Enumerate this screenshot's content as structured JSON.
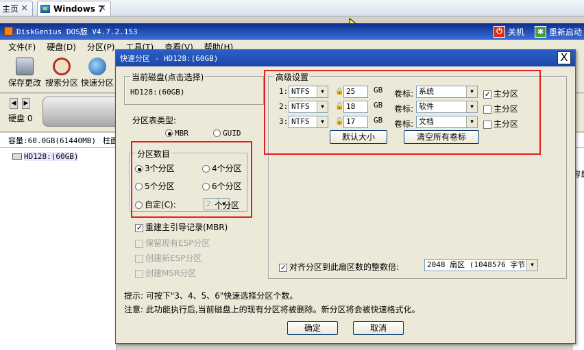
{
  "vm_tabs": [
    {
      "label": "主页"
    },
    {
      "label": "Windows 7"
    }
  ],
  "app": {
    "title": "DiskGenius DOS版 V4.7.2.153",
    "shutdown": "关机",
    "restart": "重新启动",
    "menu": [
      "文件(F)",
      "硬盘(D)",
      "分区(P)",
      "工具(T)",
      "查看(V)",
      "帮助(H)"
    ],
    "tools": [
      "保存更改",
      "搜索分区",
      "快速分区"
    ],
    "disk_label": "硬盘 0",
    "capacity": "容量:60.0GB(61440MB)",
    "cylinders": "柱面数",
    "tree_item": "HD128:(60GB)",
    "right_edge": "容量"
  },
  "dialog": {
    "title": "快速分区 - HD128:(60GB)",
    "close": "X",
    "current_disk": {
      "label": "当前磁盘(点击选择)",
      "value": "HD128:(60GB)"
    },
    "table_type": {
      "label": "分区表类型:",
      "options": [
        "MBR",
        "GUID"
      ],
      "selected": "MBR"
    },
    "count": {
      "label": "分区数目",
      "options": [
        "3个分区",
        "4个分区",
        "5个分区",
        "6个分区"
      ],
      "selected": "3个分区",
      "custom_label": "自定(C):",
      "custom_value": "2",
      "custom_suffix": "个分区"
    },
    "rebuild_mbr": {
      "label": "重建主引导记录(MBR)",
      "checked": true
    },
    "keep_esp": "保留现有ESP分区",
    "create_esp": "创建新ESP分区",
    "create_msr": "创建MSR分区",
    "advanced": {
      "label": "高级设置",
      "rows": [
        {
          "index": "1:",
          "fs": "NTFS",
          "size": "25",
          "unit": "GB",
          "vol_label": "卷标:",
          "volume": "系统",
          "primary_label": "主分区",
          "primary": true
        },
        {
          "index": "2:",
          "fs": "NTFS",
          "size": "18",
          "unit": "GB",
          "vol_label": "卷标:",
          "volume": "软件",
          "primary_label": "主分区",
          "primary": false
        },
        {
          "index": "3:",
          "fs": "NTFS",
          "size": "17",
          "unit": "GB",
          "vol_label": "卷标:",
          "volume": "文档",
          "primary_label": "主分区",
          "primary": false
        }
      ],
      "default_size": "默认大小",
      "clear_labels": "清空所有卷标"
    },
    "align": {
      "label": "对齐分区到此扇区数的整数倍:",
      "value": "2048 扇区 (1048576 字节)",
      "checked": true
    },
    "hint": "提示: 可按下\"3、4、5、6\"快速选择分区个数。",
    "note": "注意: 此功能执行后,当前磁盘上的现有分区将被删除。新分区将会被快速格式化。",
    "ok": "确定",
    "cancel": "取消"
  },
  "colors": {
    "highlight": "#e02020",
    "title_bar": "#2b5fc9"
  }
}
